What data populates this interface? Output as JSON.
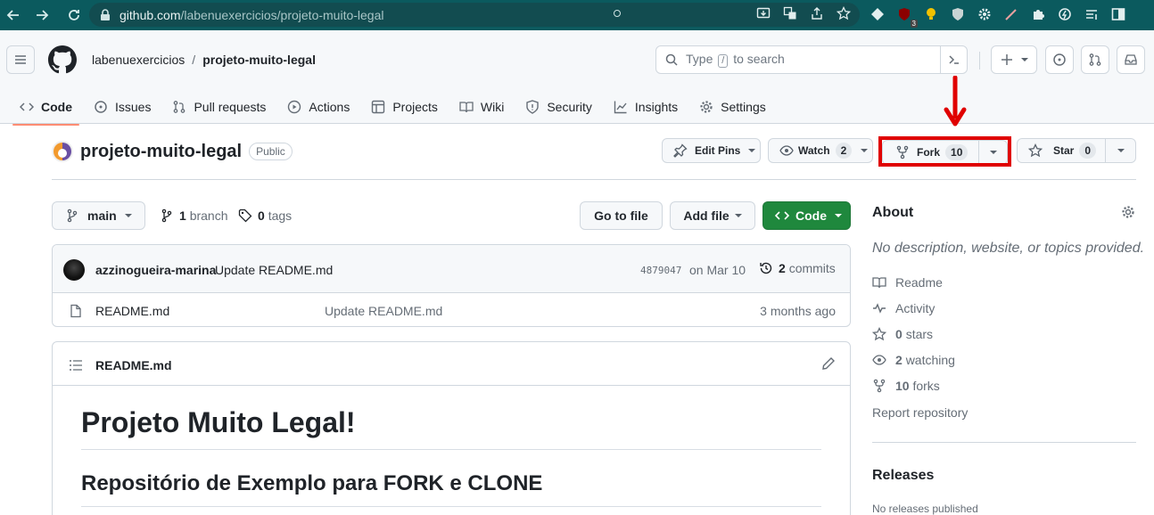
{
  "browser": {
    "url_host": "github.com",
    "url_path": "/labenuexercicios/projeto-muito-legal"
  },
  "header": {
    "owner": "labenuexercicios",
    "separator": "/",
    "repo": "projeto-muito-legal",
    "search_placeholder_pre": "Type",
    "search_key": "/",
    "search_placeholder_post": "to search"
  },
  "tabs": [
    {
      "label": "Code",
      "icon": "code-icon"
    },
    {
      "label": "Issues",
      "icon": "issue-icon"
    },
    {
      "label": "Pull requests",
      "icon": "pull-request-icon"
    },
    {
      "label": "Actions",
      "icon": "play-icon"
    },
    {
      "label": "Projects",
      "icon": "table-icon"
    },
    {
      "label": "Wiki",
      "icon": "book-icon"
    },
    {
      "label": "Security",
      "icon": "shield-icon"
    },
    {
      "label": "Insights",
      "icon": "graph-icon"
    },
    {
      "label": "Settings",
      "icon": "gear-icon"
    }
  ],
  "repo_header": {
    "name": "projeto-muito-legal",
    "visibility": "Public",
    "edit_pins": "Edit Pins",
    "watch": "Watch",
    "watch_count": "2",
    "fork": "Fork",
    "fork_count": "10",
    "star": "Star",
    "star_count": "0"
  },
  "file_nav": {
    "branch": "main",
    "branch_count": "1",
    "branch_label": "branch",
    "tag_count": "0",
    "tag_label": "tags",
    "go_to_file": "Go to file",
    "add_file": "Add file",
    "code": "Code"
  },
  "latest_commit": {
    "author": "azzinogueira-marina",
    "message": "Update README.md",
    "sha": "4879047",
    "date": "on Mar 10",
    "count": "2",
    "count_label": "commits"
  },
  "files": [
    {
      "name": "README.md",
      "message": "Update README.md",
      "age": "3 months ago"
    }
  ],
  "readme": {
    "filename": "README.md",
    "h1": "Projeto Muito Legal!",
    "h2": "Repositório de Exemplo para FORK e CLONE"
  },
  "sidebar": {
    "about_title": "About",
    "description": "No description, website, or topics provided.",
    "items": [
      {
        "icon": "book-icon",
        "count": "",
        "label": "Readme"
      },
      {
        "icon": "pulse-icon",
        "count": "",
        "label": "Activity"
      },
      {
        "icon": "star-icon",
        "count": "0",
        "label": "stars"
      },
      {
        "icon": "eye-icon",
        "count": "2",
        "label": "watching"
      },
      {
        "icon": "fork-icon",
        "count": "10",
        "label": "forks"
      }
    ],
    "report": "Report repository",
    "releases_title": "Releases",
    "releases_none": "No releases published"
  },
  "colors": {
    "annotation_red": "#e00000",
    "browser_bar": "#0b5a5e",
    "code_button": "#1f883d",
    "active_tab_underline": "#fd8c73"
  }
}
